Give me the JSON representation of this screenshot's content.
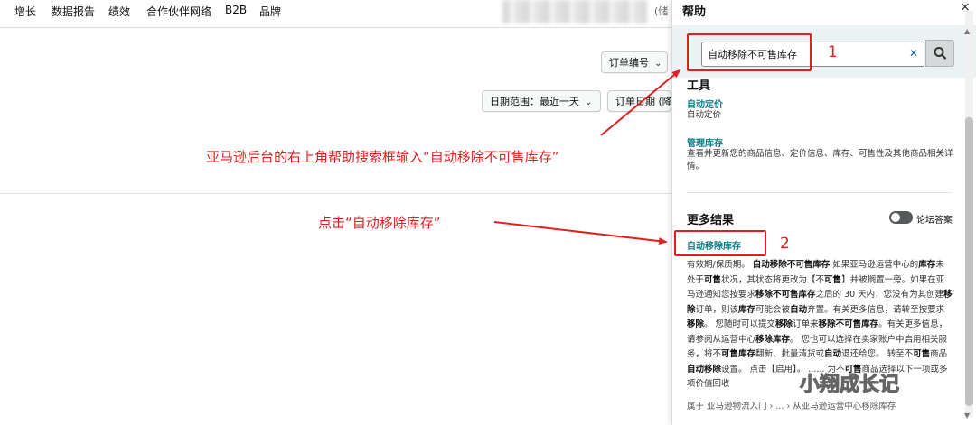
{
  "nav": {
    "items": [
      "增长",
      "数据报告",
      "绩效",
      "合作伙伴网络",
      "B2B",
      "品牌"
    ],
    "cut_text": "(储"
  },
  "filters": {
    "order_number": "订单编号",
    "date_range_label": "日期范围：",
    "date_range_value": "最近一天",
    "order_date": "订单日期 (降"
  },
  "help": {
    "title": "帮助",
    "close": "×",
    "search_value": "自动移除不可售库存",
    "tools_heading": "工具",
    "tools": [
      {
        "link": "自动定价",
        "desc": "自动定价"
      },
      {
        "link": "管理库存",
        "desc": "查看并更新您的商品信息、定价信息、库存、可售性及其他商品相关详情。"
      }
    ],
    "more_results_heading": "更多结果",
    "toggle_label": "论坛答案",
    "result_link": "自动移除库存",
    "result_body_html": "有效期/保质期。 <b>自动移除不可售库存</b> 如果亚马逊运营中心的<b>库存</b>未处于<b>可售</b>状况，其状态将更改为【不<b>可售</b>】并被搁置一旁。如果在亚马逊通知您按要求<b>移除不可售库存</b>之后的 30 天内，您没有为其创建<b>移除</b>订单，则该<b>库存</b>可能会被<b>自动</b>弃置。有关更多信息，请转至按要求<b>移除</b>。 您随时可以提交<b>移除</b>订单来<b>移除不可售库存</b>。有关更多信息，请参阅从运营中心<b>移除库存</b>。 您也可以选择在卖家账户中启用相关服务，将不<b>可售库存</b>翻新、批量清货或<b>自动</b>退还给您。 转至不<b>可售</b>商品<b>自动移除</b>设置。 点击【启用】。 ...... 为不<b>可售</b>商品选择以下一项或多项价值回收",
    "breadcrumb": "属于 亚马逊物流入门 › ... › 从亚马逊运营中心移除库存"
  },
  "annotations": {
    "num1": "1",
    "num2": "2",
    "caption1": "亚马逊后台的右上角帮助搜索框输入“自动移除不可售库存”",
    "caption2": "点击“自动移除库存”",
    "watermark": "小翔成长记",
    "color": "#e02020"
  }
}
